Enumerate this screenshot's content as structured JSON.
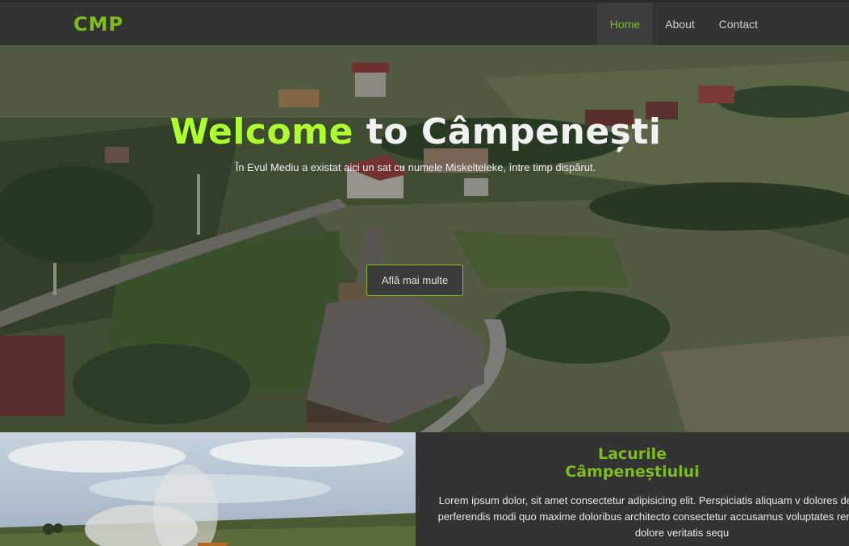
{
  "brand": {
    "logo": "CMP"
  },
  "nav": {
    "items": [
      {
        "label": "Home",
        "active": true
      },
      {
        "label": "About",
        "active": false
      },
      {
        "label": "Contact",
        "active": false
      }
    ]
  },
  "hero": {
    "title_accent": "Welcome",
    "title_rest": " to Câmpenești",
    "subtitle": "În Evul Mediu a existat aici un sat cu numele Miskelteleke, între timp dispărut.",
    "button_label": "Află mai multe"
  },
  "lakes": {
    "title_line1": "Lacurile",
    "title_line2": "Câmpeneștiului",
    "body": "Lorem ipsum dolor, sit amet consectetur adipisicing elit. Perspiciatis aliquam v dolores delectus voluptate perferendis modi quo maxime doloribus architecto consectetur accusamus voluptates rerum accusantium dolore veritatis sequ"
  },
  "colors": {
    "accent": "#7fbc1e",
    "hero_accent": "#adff2f",
    "bar": "#333333"
  }
}
